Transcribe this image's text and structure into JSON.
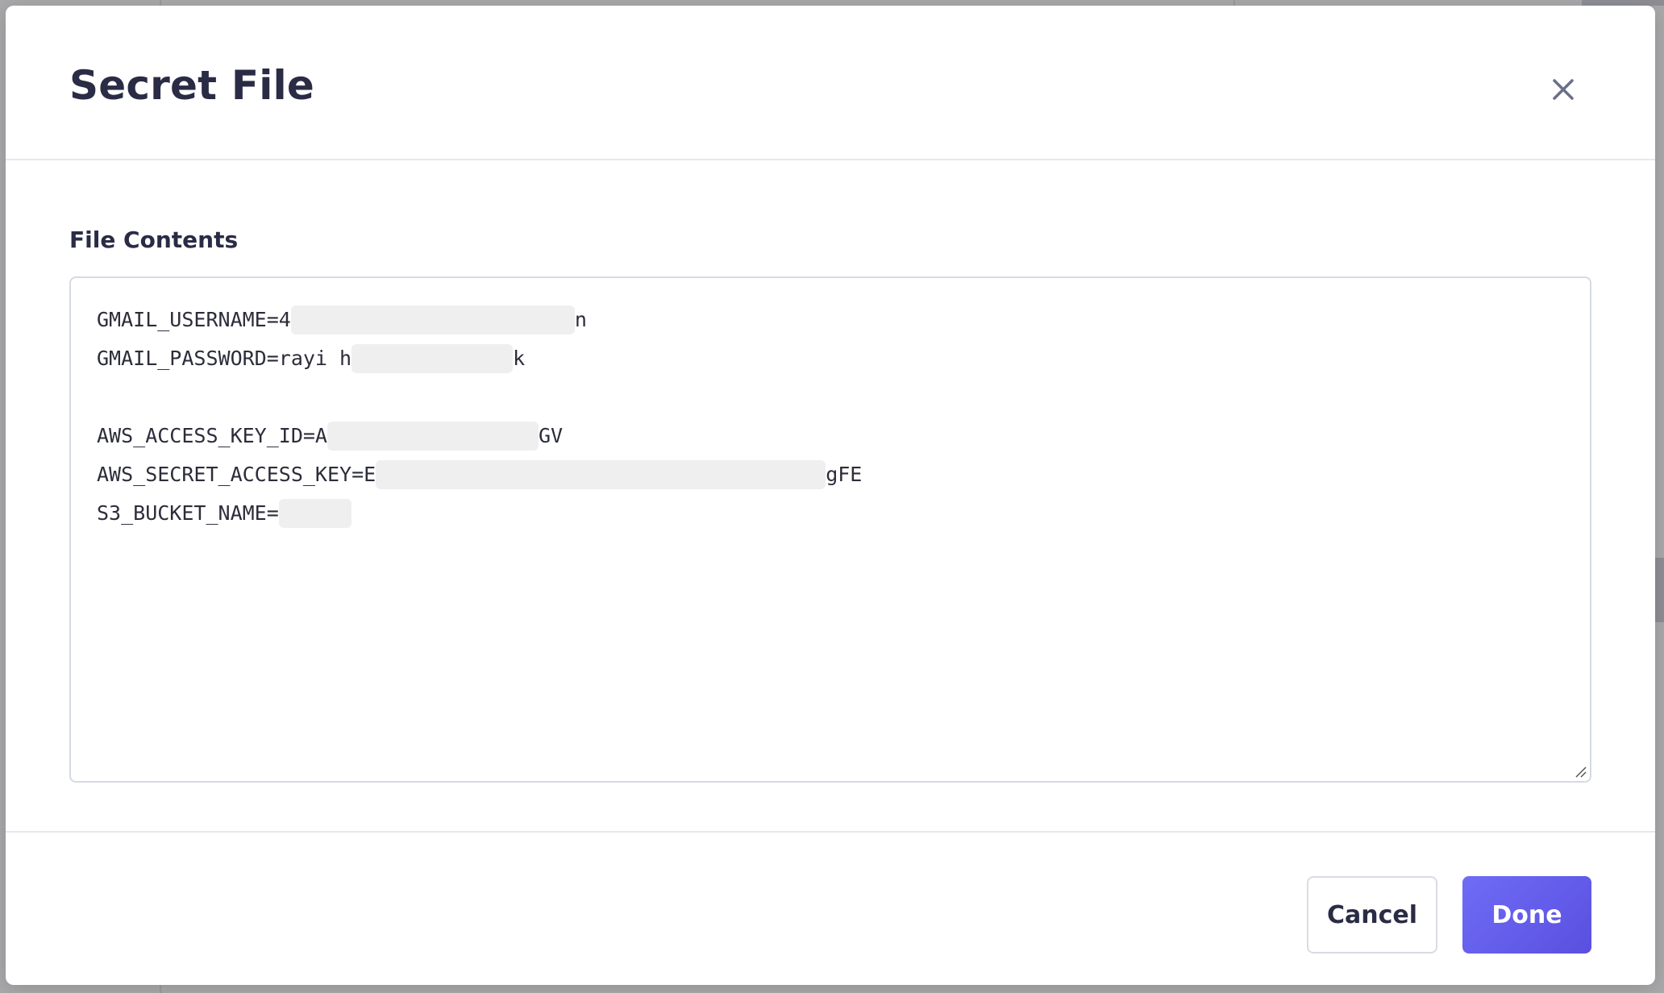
{
  "dialog": {
    "title": "Secret File",
    "field_label": "File Contents",
    "close_icon": "close-icon",
    "lines": [
      {
        "prefix": "GMAIL_USERNAME=4",
        "suffix": "n"
      },
      {
        "prefix": "GMAIL_PASSWORD=rayi h",
        "suffix": "k"
      },
      {
        "prefix": "",
        "suffix": ""
      },
      {
        "prefix": "AWS_ACCESS_KEY_ID=A",
        "suffix": "GV"
      },
      {
        "prefix": "AWS_SECRET_ACCESS_KEY=E",
        "suffix": "gFE"
      },
      {
        "prefix": "S3_BUCKET_NAME=",
        "suffix": ""
      }
    ],
    "cancel_label": "Cancel",
    "done_label": "Done"
  },
  "colors": {
    "title_text": "#2a2c45",
    "primary_button": "#5a4fe0",
    "redaction": "#efefef",
    "overlay": "#a9a9ab"
  }
}
